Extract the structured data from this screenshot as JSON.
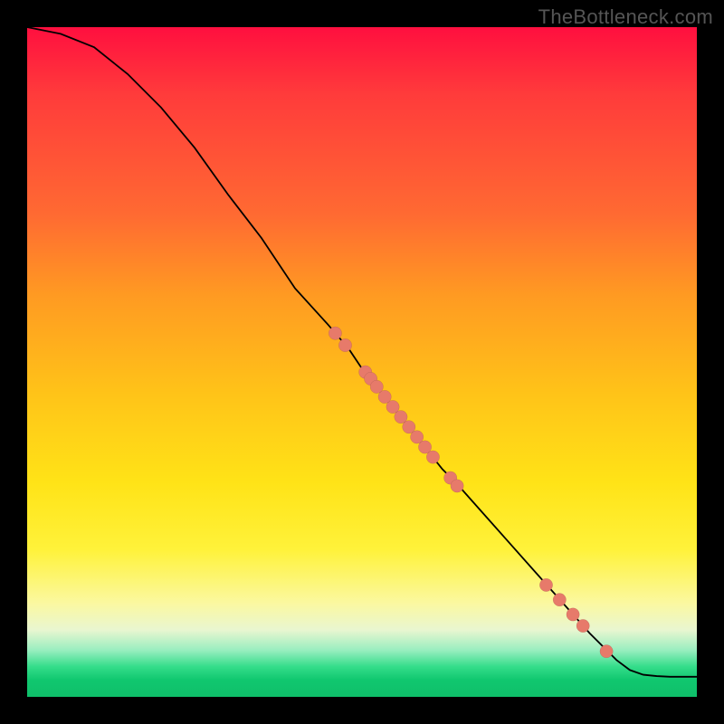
{
  "watermark": "TheBottleneck.com",
  "colors": {
    "frame_bg": "#000000",
    "curve": "#000000",
    "dot_fill": "#e77a6a",
    "gradient_top": "#ff0f3f",
    "gradient_bottom": "#0fbf6a"
  },
  "chart_data": {
    "type": "line",
    "title": "",
    "xlabel": "",
    "ylabel": "",
    "xlim": [
      0,
      100
    ],
    "ylim": [
      0,
      100
    ],
    "grid": false,
    "legend": false,
    "curve": [
      {
        "x": 0,
        "y": 100
      },
      {
        "x": 5,
        "y": 99
      },
      {
        "x": 10,
        "y": 97
      },
      {
        "x": 15,
        "y": 93
      },
      {
        "x": 20,
        "y": 88
      },
      {
        "x": 25,
        "y": 82
      },
      {
        "x": 30,
        "y": 75
      },
      {
        "x": 35,
        "y": 68.5
      },
      {
        "x": 40,
        "y": 61
      },
      {
        "x": 45,
        "y": 55.5
      },
      {
        "x": 48,
        "y": 52
      },
      {
        "x": 50,
        "y": 49
      },
      {
        "x": 52,
        "y": 46.5
      },
      {
        "x": 54,
        "y": 44
      },
      {
        "x": 56,
        "y": 41.5
      },
      {
        "x": 58,
        "y": 39
      },
      {
        "x": 60,
        "y": 36.5
      },
      {
        "x": 62,
        "y": 34
      },
      {
        "x": 64,
        "y": 32
      },
      {
        "x": 68,
        "y": 27.5
      },
      {
        "x": 72,
        "y": 23
      },
      {
        "x": 76,
        "y": 18.5
      },
      {
        "x": 80,
        "y": 14
      },
      {
        "x": 84,
        "y": 9.5
      },
      {
        "x": 88,
        "y": 5.5
      },
      {
        "x": 90,
        "y": 4
      },
      {
        "x": 92,
        "y": 3.3
      },
      {
        "x": 94,
        "y": 3.1
      },
      {
        "x": 96,
        "y": 3
      },
      {
        "x": 100,
        "y": 3
      }
    ],
    "points": [
      {
        "x": 46,
        "y": 54.3
      },
      {
        "x": 47.5,
        "y": 52.5
      },
      {
        "x": 50.5,
        "y": 48.5
      },
      {
        "x": 51.3,
        "y": 47.5
      },
      {
        "x": 52.2,
        "y": 46.3
      },
      {
        "x": 53.4,
        "y": 44.8
      },
      {
        "x": 54.6,
        "y": 43.3
      },
      {
        "x": 55.8,
        "y": 41.8
      },
      {
        "x": 57,
        "y": 40.3
      },
      {
        "x": 58.2,
        "y": 38.8
      },
      {
        "x": 59.4,
        "y": 37.3
      },
      {
        "x": 60.6,
        "y": 35.8
      },
      {
        "x": 63.2,
        "y": 32.7
      },
      {
        "x": 64.2,
        "y": 31.5
      },
      {
        "x": 77.5,
        "y": 16.7
      },
      {
        "x": 79.5,
        "y": 14.5
      },
      {
        "x": 81.5,
        "y": 12.3
      },
      {
        "x": 83,
        "y": 10.6
      },
      {
        "x": 86.5,
        "y": 6.8
      }
    ]
  }
}
